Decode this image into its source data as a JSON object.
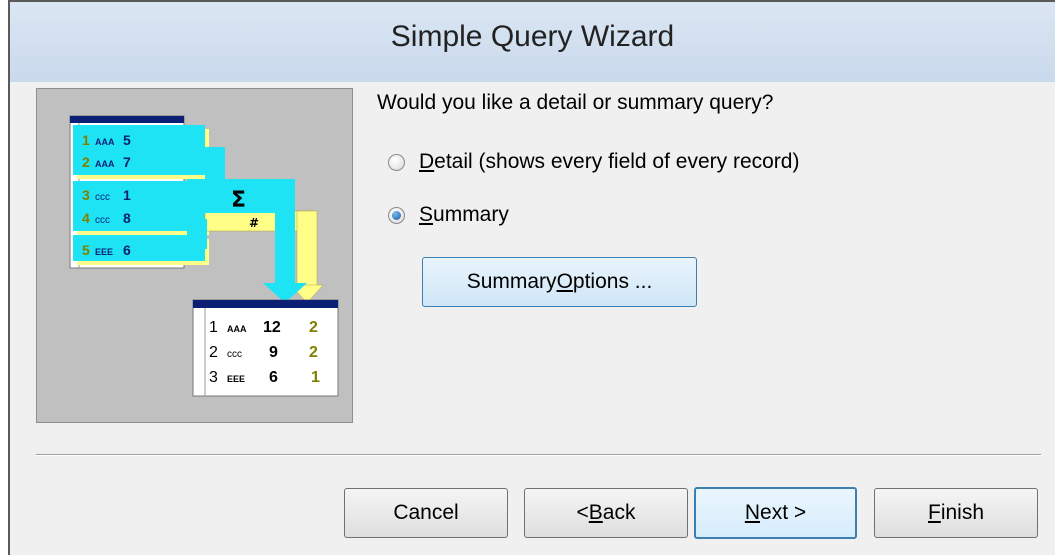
{
  "window": {
    "title": "Simple Query Wizard"
  },
  "prompt": {
    "question": "Would you like a detail or summary query?"
  },
  "options": {
    "detail": {
      "label_key": "D",
      "label_rest": "etail (shows every field of every record)",
      "selected": false
    },
    "summary": {
      "label_key": "S",
      "label_rest": "ummary",
      "selected": true
    }
  },
  "summary_options_button": {
    "label_pre": "Summary ",
    "label_key": "O",
    "label_post": "ptions ..."
  },
  "buttons": {
    "cancel": {
      "label": "Cancel"
    },
    "back": {
      "label_pre": "< ",
      "label_key": "B",
      "label_post": "ack"
    },
    "next": {
      "label_key": "N",
      "label_post": "ext >"
    },
    "finish": {
      "label_key": "F",
      "label_post": "inish"
    }
  },
  "illustration": {
    "source_rows": [
      {
        "num": "1",
        "code": "AAA",
        "value": "5"
      },
      {
        "num": "2",
        "code": "AAA",
        "value": "7"
      },
      {
        "num": "3",
        "code": "ccc",
        "value": "1"
      },
      {
        "num": "4",
        "code": "ccc",
        "value": "8"
      },
      {
        "num": "5",
        "code": "EEE",
        "value": "6"
      }
    ],
    "sum_symbol": "Σ",
    "count_symbol": "#",
    "result_rows": [
      {
        "num": "1",
        "code": "AAA",
        "sum": "12",
        "count": "2"
      },
      {
        "num": "2",
        "code": "ccc",
        "sum": "9",
        "count": "2"
      },
      {
        "num": "3",
        "code": "EEE",
        "sum": "6",
        "count": "1"
      }
    ],
    "colors": {
      "cyan": "#1ee3f5",
      "yellow": "#ffff88",
      "navy": "#0b1f74",
      "olive": "#808000"
    }
  }
}
